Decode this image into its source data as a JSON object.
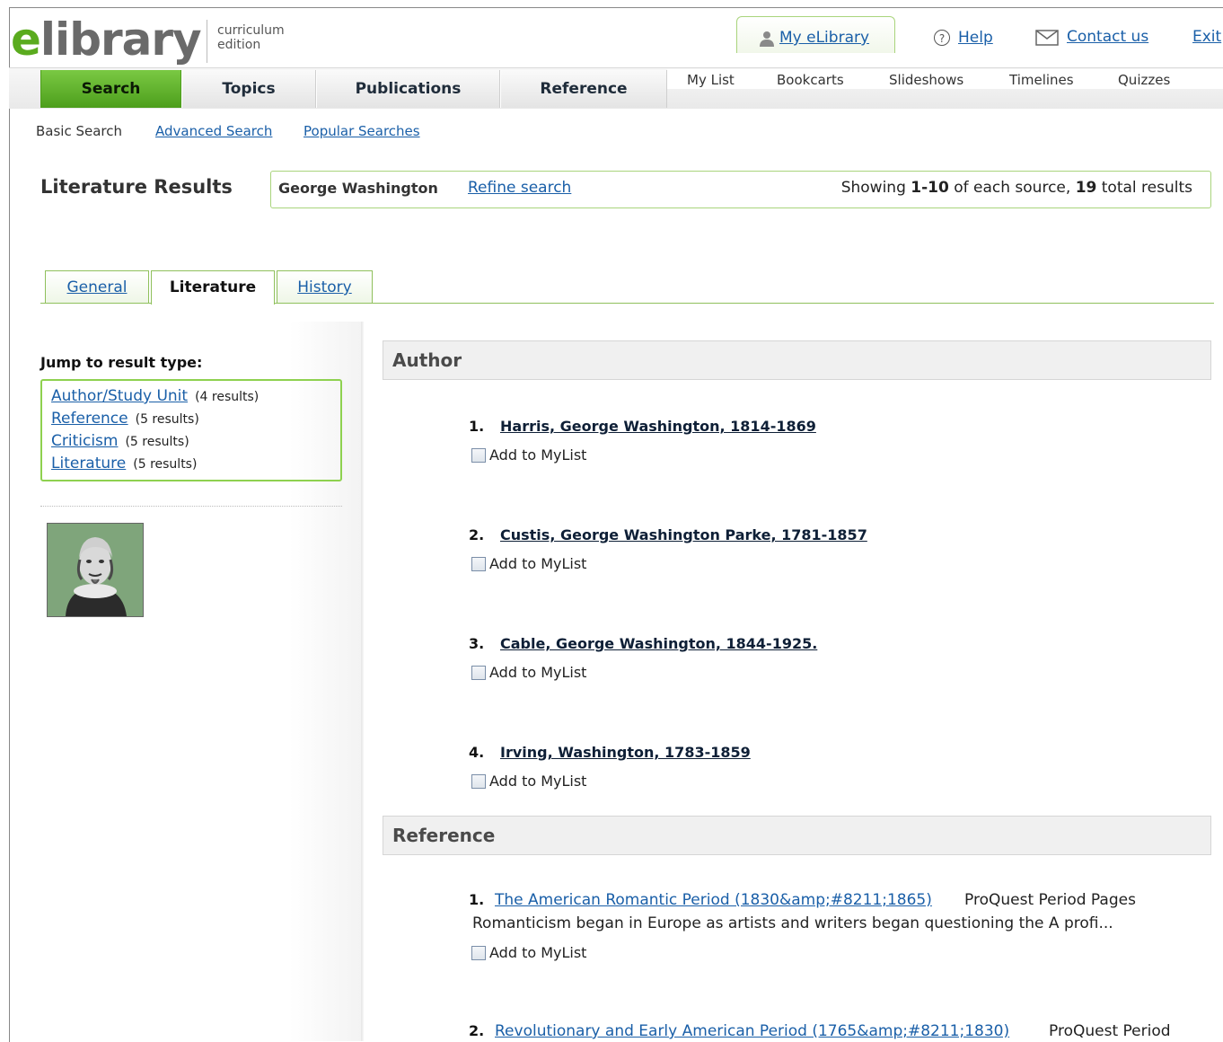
{
  "header": {
    "logo_e": "e",
    "logo_rest": "library",
    "edition_line1": "curriculum",
    "edition_line2": "edition",
    "my_elibrary": "My eLibrary",
    "help": "Help",
    "contact": "Contact us",
    "exit": "Exit"
  },
  "nav": {
    "tabs": [
      "Search",
      "Topics",
      "Publications",
      "Reference"
    ],
    "subnav": [
      "My List",
      "Bookcarts",
      "Slideshows",
      "Timelines",
      "Quizzes"
    ]
  },
  "search_links": {
    "basic": "Basic Search",
    "advanced": "Advanced Search",
    "popular": "Popular Searches"
  },
  "results": {
    "title": "Literature Results",
    "query": "George Washington",
    "refine": "Refine search",
    "showing_prefix": "Showing ",
    "range": "1-10",
    "middle": " of each source, ",
    "total": "19",
    "suffix": " total results"
  },
  "source_tabs": [
    "General",
    "Literature",
    "History"
  ],
  "sidebar": {
    "jump_title": "Jump to result type:",
    "items": [
      {
        "label": "Author/Study Unit",
        "count": "(4 results)"
      },
      {
        "label": "Reference",
        "count": "(5 results)"
      },
      {
        "label": "Criticism",
        "count": "(5 results)"
      },
      {
        "label": "Literature",
        "count": "(5 results)"
      }
    ]
  },
  "sections": {
    "author": {
      "title": "Author",
      "results": [
        {
          "num": "1.",
          "title": "Harris, George Washington, 1814-1869"
        },
        {
          "num": "2.",
          "title": "Custis, George Washington Parke, 1781-1857"
        },
        {
          "num": "3.",
          "title": "Cable, George Washington, 1844-1925."
        },
        {
          "num": "4.",
          "title": "Irving, Washington, 1783-1859"
        }
      ]
    },
    "reference": {
      "title": "Reference",
      "results": [
        {
          "num": "1.",
          "title": "The American Romantic Period (1830&amp;#8211;1865)",
          "source": "ProQuest Period Pages",
          "snippet": "Romanticism began in Europe as artists and writers began questioning the A profi..."
        },
        {
          "num": "2.",
          "title": "Revolutionary and Early American Period (1765&amp;#8211;1830)",
          "source": "ProQuest Period"
        }
      ]
    }
  },
  "add_to_mylist": "Add to MyList",
  "colors": {
    "accent_green": "#5aab1e",
    "link_blue": "#1a5fa8"
  }
}
